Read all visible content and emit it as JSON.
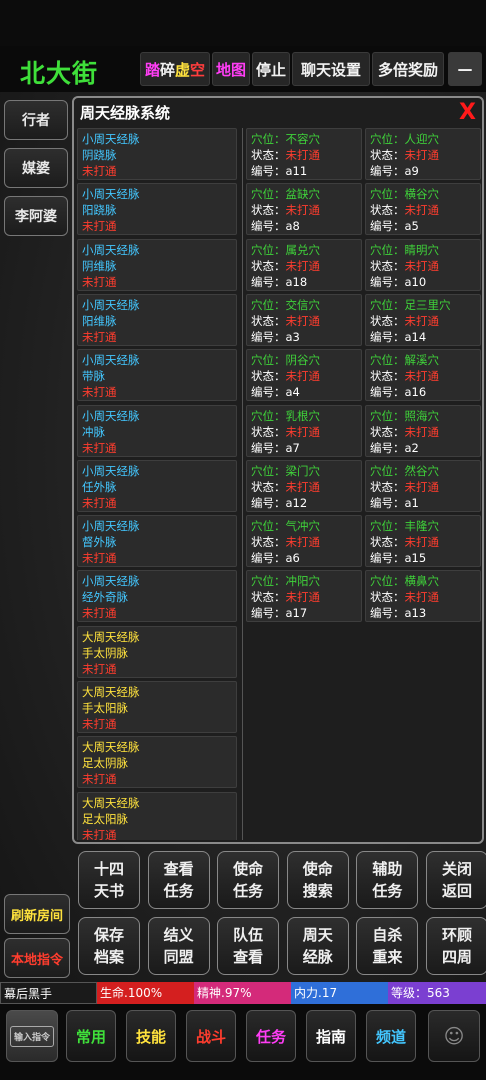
{
  "header": {
    "location": "北大街",
    "buttons": [
      {
        "id": "tapo",
        "parts": [
          "踏",
          "碎",
          "虚",
          "空"
        ]
      },
      {
        "id": "map",
        "label": "地图"
      },
      {
        "id": "stop",
        "label": "停止"
      },
      {
        "id": "chat",
        "label": "聊天设置"
      },
      {
        "id": "reward",
        "label": "多倍奖励"
      },
      {
        "id": "menu",
        "label": "—"
      }
    ]
  },
  "npcs": [
    "行者",
    "媒婆",
    "李阿婆"
  ],
  "side_buttons": {
    "refresh": "刷新房间",
    "local": "本地指令"
  },
  "panel": {
    "title": "周天经脉系统",
    "close": "X",
    "meridians": [
      {
        "type": "小周天经脉",
        "name": "阴跷脉",
        "state": "未打通",
        "kind": "small"
      },
      {
        "type": "小周天经脉",
        "name": "阳跷脉",
        "state": "未打通",
        "kind": "small"
      },
      {
        "type": "小周天经脉",
        "name": "阴维脉",
        "state": "未打通",
        "kind": "small"
      },
      {
        "type": "小周天经脉",
        "name": "阳维脉",
        "state": "未打通",
        "kind": "small"
      },
      {
        "type": "小周天经脉",
        "name": "带脉",
        "state": "未打通",
        "kind": "small"
      },
      {
        "type": "小周天经脉",
        "name": "冲脉",
        "state": "未打通",
        "kind": "small"
      },
      {
        "type": "小周天经脉",
        "name": "任外脉",
        "state": "未打通",
        "kind": "small"
      },
      {
        "type": "小周天经脉",
        "name": "督外脉",
        "state": "未打通",
        "kind": "small"
      },
      {
        "type": "小周天经脉",
        "name": "经外奇脉",
        "state": "未打通",
        "kind": "small"
      },
      {
        "type": "大周天经脉",
        "name": "手太阴脉",
        "state": "未打通",
        "kind": "big"
      },
      {
        "type": "大周天经脉",
        "name": "手太阳脉",
        "state": "未打通",
        "kind": "big"
      },
      {
        "type": "大周天经脉",
        "name": "足太阴脉",
        "state": "未打通",
        "kind": "big"
      },
      {
        "type": "大周天经脉",
        "name": "足太阳脉",
        "state": "未打通",
        "kind": "big"
      }
    ],
    "acupoints": [
      {
        "point": "穴位：不容穴",
        "state_label": "状态：",
        "state": "未打通",
        "code_label": "编号：",
        "code": "a11"
      },
      {
        "point": "穴位：人迎穴",
        "state_label": "状态：",
        "state": "未打通",
        "code_label": "编号：",
        "code": "a9"
      },
      {
        "point": "穴位：盆缺穴",
        "state_label": "状态：",
        "state": "未打通",
        "code_label": "编号：",
        "code": "a8"
      },
      {
        "point": "穴位：横谷穴",
        "state_label": "状态：",
        "state": "未打通",
        "code_label": "编号：",
        "code": "a5"
      },
      {
        "point": "穴位：属兑穴",
        "state_label": "状态：",
        "state": "未打通",
        "code_label": "编号：",
        "code": "a18"
      },
      {
        "point": "穴位：睛明穴",
        "state_label": "状态：",
        "state": "未打通",
        "code_label": "编号：",
        "code": "a10"
      },
      {
        "point": "穴位：交信穴",
        "state_label": "状态：",
        "state": "未打通",
        "code_label": "编号：",
        "code": "a3"
      },
      {
        "point": "穴位：足三里穴",
        "state_label": "状态：",
        "state": "未打通",
        "code_label": "编号：",
        "code": "a14"
      },
      {
        "point": "穴位：阴谷穴",
        "state_label": "状态：",
        "state": "未打通",
        "code_label": "编号：",
        "code": "a4"
      },
      {
        "point": "穴位：解溪穴",
        "state_label": "状态：",
        "state": "未打通",
        "code_label": "编号：",
        "code": "a16"
      },
      {
        "point": "穴位：乳根穴",
        "state_label": "状态：",
        "state": "未打通",
        "code_label": "编号：",
        "code": "a7"
      },
      {
        "point": "穴位：照海穴",
        "state_label": "状态：",
        "state": "未打通",
        "code_label": "编号：",
        "code": "a2"
      },
      {
        "point": "穴位：梁门穴",
        "state_label": "状态：",
        "state": "未打通",
        "code_label": "编号：",
        "code": "a12"
      },
      {
        "point": "穴位：然谷穴",
        "state_label": "状态：",
        "state": "未打通",
        "code_label": "编号：",
        "code": "a1"
      },
      {
        "point": "穴位：气冲穴",
        "state_label": "状态：",
        "state": "未打通",
        "code_label": "编号：",
        "code": "a6"
      },
      {
        "point": "穴位：丰隆穴",
        "state_label": "状态：",
        "state": "未打通",
        "code_label": "编号：",
        "code": "a15"
      },
      {
        "point": "穴位：冲阳穴",
        "state_label": "状态：",
        "state": "未打通",
        "code_label": "编号：",
        "code": "a17"
      },
      {
        "point": "穴位：横鼻穴",
        "state_label": "状态：",
        "state": "未打通",
        "code_label": "编号：",
        "code": "a13"
      }
    ]
  },
  "actions": [
    {
      "l1": "十四",
      "l2": "天书"
    },
    {
      "l1": "查看",
      "l2": "任务"
    },
    {
      "l1": "使命",
      "l2": "任务"
    },
    {
      "l1": "使命",
      "l2": "搜索"
    },
    {
      "l1": "辅助",
      "l2": "任务"
    },
    {
      "l1": "关闭",
      "l2": "返回"
    },
    {
      "l1": "保存",
      "l2": "档案"
    },
    {
      "l1": "结义",
      "l2": "同盟"
    },
    {
      "l1": "队伍",
      "l2": "查看"
    },
    {
      "l1": "周天",
      "l2": "经脉"
    },
    {
      "l1": "自杀",
      "l2": "重来"
    },
    {
      "l1": "环顾",
      "l2": "四周"
    }
  ],
  "status": {
    "name": "幕后黑手",
    "hp": "生命.100%",
    "spirit": "精神.97%",
    "neili": "内力.17",
    "level": "等级：563"
  },
  "nav": {
    "input": "输入指令",
    "tabs": [
      "常用",
      "技能",
      "战斗",
      "任务",
      "指南",
      "频道"
    ]
  },
  "colors": {
    "hp": "#d41f1f",
    "spirit": "#d42a7a",
    "neili": "#2f6fd9",
    "level": "#7b3fd1"
  }
}
